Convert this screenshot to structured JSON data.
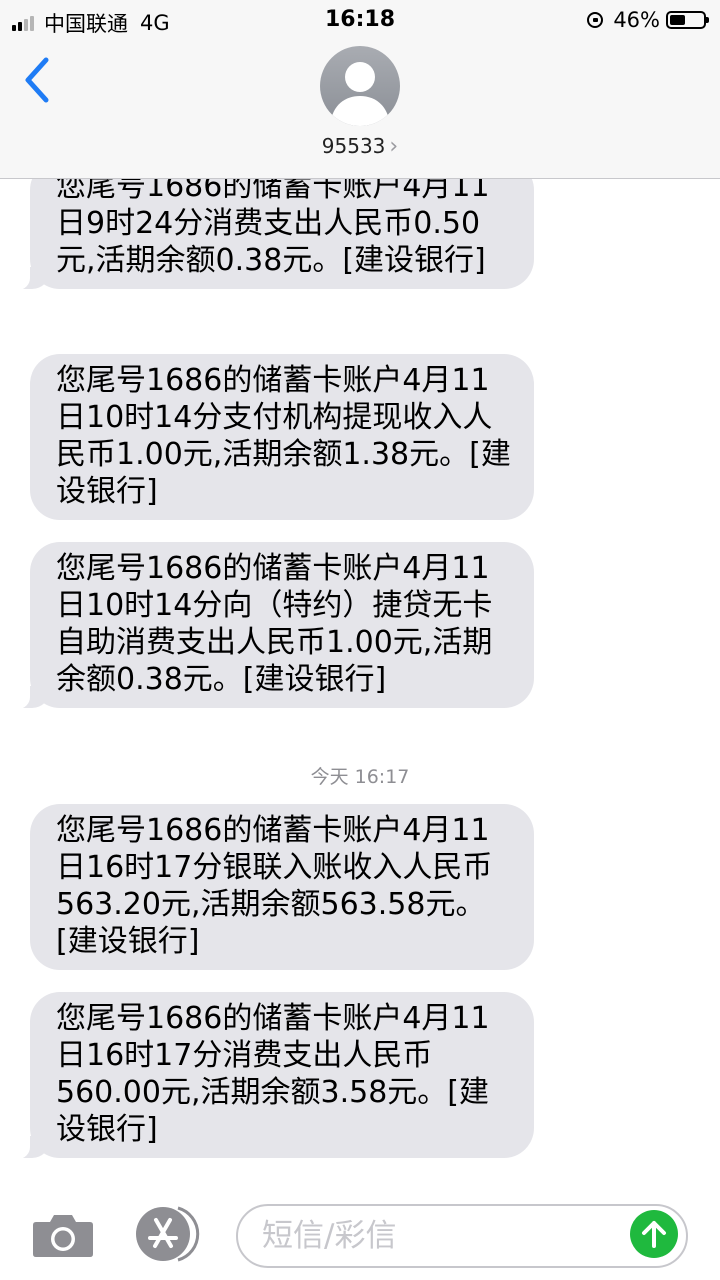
{
  "status_bar": {
    "carrier": "中国联通",
    "network": "4G",
    "time": "16:18",
    "battery": "46%",
    "battery_level": 0.46
  },
  "header": {
    "contact": "95533",
    "chevron": "›",
    "back_icon": "chevron-left-icon",
    "avatar_icon": "person-silhouette-icon"
  },
  "messages": [
    {
      "text": "您尾号1686的储蓄卡账户4月11日9时24分消费支出人民币0.50元,活期余额0.38元。[建设银行]"
    },
    {
      "text": "您尾号1686的储蓄卡账户4月11日10时14分支付机构提现收入人民币1.00元,活期余额1.38元。[建设银行]"
    },
    {
      "text": "您尾号1686的储蓄卡账户4月11日10时14分向（特约）捷贷无卡自助消费支出人民币1.00元,活期余额0.38元。[建设银行]"
    },
    {
      "text": "您尾号1686的储蓄卡账户4月11日16时17分银联入账收入人民币563.20元,活期余额563.58元。[建设银行]"
    },
    {
      "text": "您尾号1686的储蓄卡账户4月11日16时17分消费支出人民币560.00元,活期余额3.58元。[建设银行]"
    }
  ],
  "timestamp": "今天 16:17",
  "input_bar": {
    "placeholder": "短信/彩信",
    "camera_icon": "camera-icon",
    "apps_icon": "app-store-icon",
    "send_icon": "arrow-up-icon"
  },
  "colors": {
    "accent": "#1f7cf5",
    "bubble": "#e5e5ea",
    "send": "#1fb93e"
  }
}
